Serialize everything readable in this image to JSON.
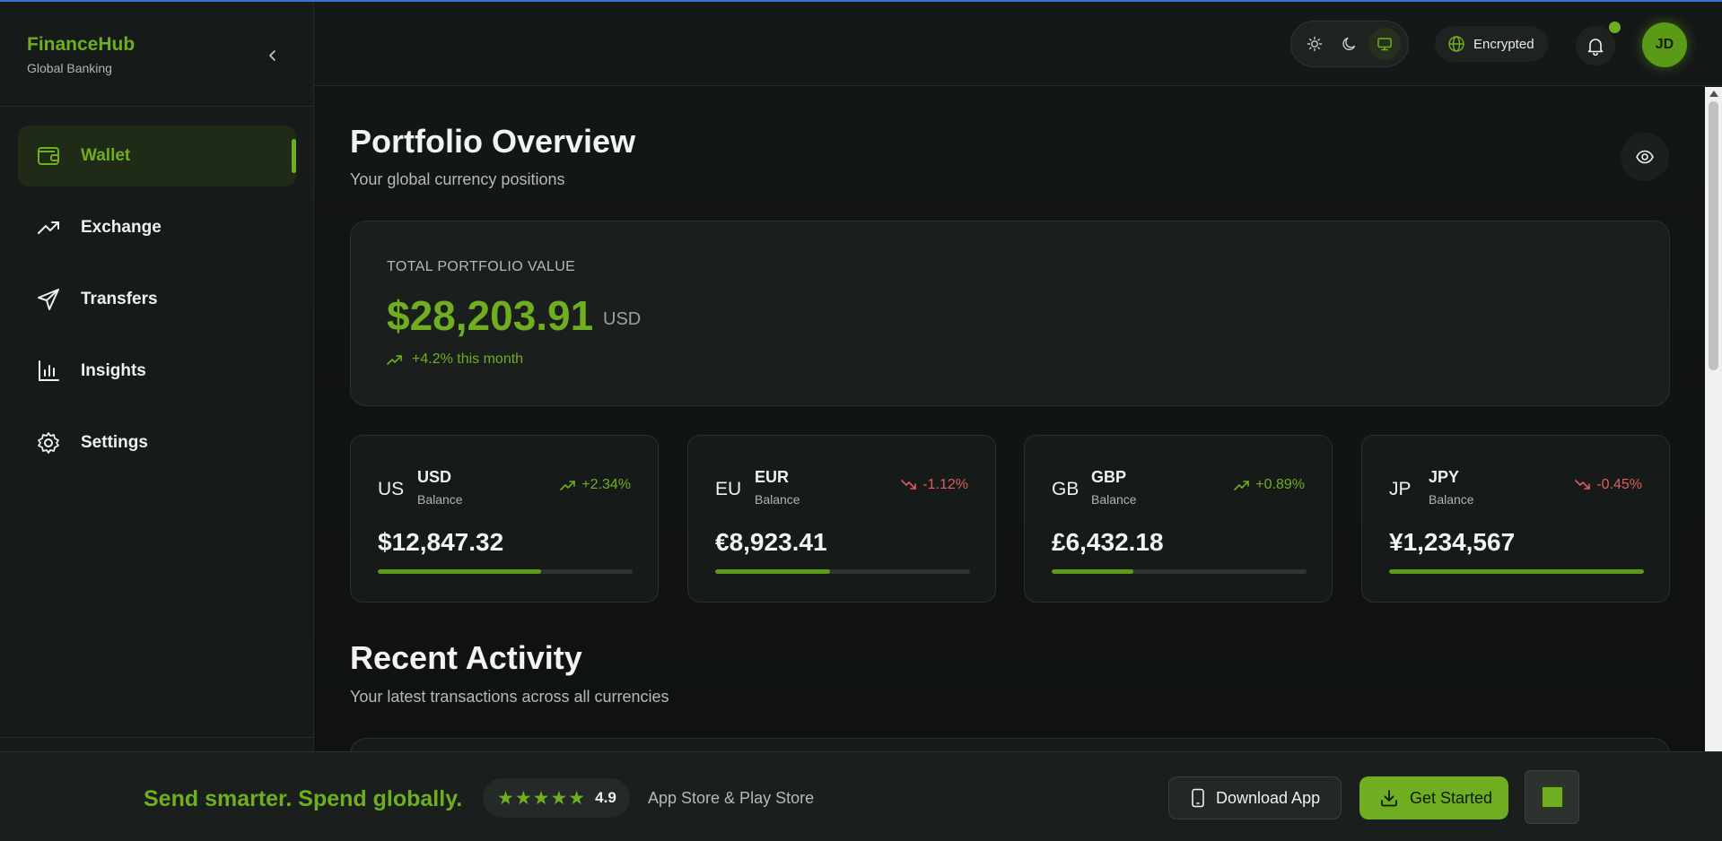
{
  "brand": {
    "name": "FinanceHub",
    "subtitle": "Global Banking"
  },
  "sidebar": {
    "items": [
      {
        "label": "Wallet",
        "icon": "wallet-icon",
        "active": true
      },
      {
        "label": "Exchange",
        "icon": "trending-up-icon",
        "active": false
      },
      {
        "label": "Transfers",
        "icon": "send-icon",
        "active": false
      },
      {
        "label": "Insights",
        "icon": "bar-chart-icon",
        "active": false
      },
      {
        "label": "Settings",
        "icon": "gear-icon",
        "active": false
      }
    ]
  },
  "header": {
    "theme_options": [
      "sun-icon",
      "moon-icon",
      "monitor-icon"
    ],
    "theme_active": "monitor-icon",
    "encrypted_label": "Encrypted",
    "avatar_initials": "JD"
  },
  "portfolio": {
    "title": "Portfolio Overview",
    "subtitle": "Your global currency positions",
    "total_label": "TOTAL PORTFOLIO VALUE",
    "total_value": "$28,203.91",
    "total_currency": "USD",
    "total_change": "+4.2% this month"
  },
  "currencies": [
    {
      "short": "US",
      "code": "USD",
      "balance_label": "Balance",
      "change": "+2.34%",
      "direction": "up",
      "amount": "$12,847.32",
      "progress": 0.64
    },
    {
      "short": "EU",
      "code": "EUR",
      "balance_label": "Balance",
      "change": "-1.12%",
      "direction": "down",
      "amount": "€8,923.41",
      "progress": 0.45
    },
    {
      "short": "GB",
      "code": "GBP",
      "balance_label": "Balance",
      "change": "+0.89%",
      "direction": "up",
      "amount": "£6,432.18",
      "progress": 0.32
    },
    {
      "short": "JP",
      "code": "JPY",
      "balance_label": "Balance",
      "change": "-0.45%",
      "direction": "down",
      "amount": "¥1,234,567",
      "progress": 1.0
    }
  ],
  "activity": {
    "title": "Recent Activity",
    "subtitle": "Your latest transactions across all currencies"
  },
  "banner": {
    "slogan": "Send smarter. Spend globally.",
    "stars": "★★★★★",
    "rating": "4.9",
    "store_text": "App Store & Play Store",
    "download_label": "Download App",
    "get_started_label": "Get Started"
  },
  "colors": {
    "accent": "#6fae21",
    "negative": "#e05c5c",
    "background": "#0f1211"
  }
}
